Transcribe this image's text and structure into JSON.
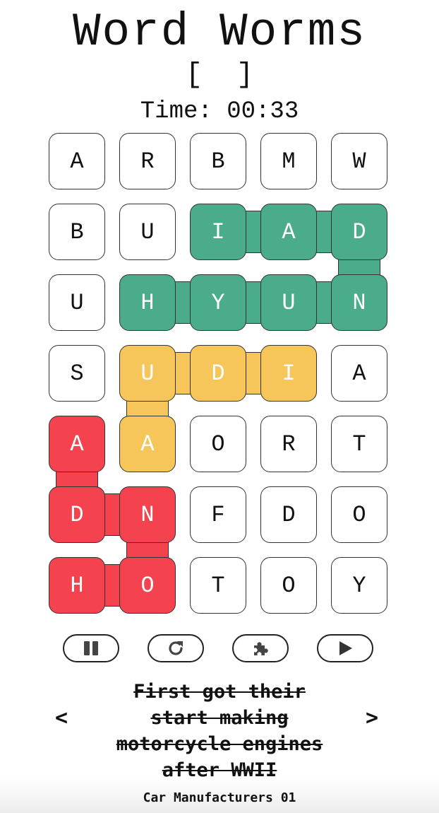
{
  "header": {
    "title": "Word Worms",
    "brackets": "[  ]",
    "timer": "Time: 00:33"
  },
  "colors": {
    "green": "#4aac8a",
    "yellow": "#f6c65a",
    "red": "#f4434e"
  },
  "grid": {
    "rows": [
      [
        "A",
        "R",
        "B",
        "M",
        "W"
      ],
      [
        "B",
        "U",
        "I",
        "A",
        "D"
      ],
      [
        "U",
        "H",
        "Y",
        "U",
        "N"
      ],
      [
        "S",
        "U",
        "D",
        "I",
        "A"
      ],
      [
        "A",
        "A",
        "O",
        "R",
        "T"
      ],
      [
        "D",
        "N",
        "F",
        "D",
        "O"
      ],
      [
        "H",
        "O",
        "T",
        "O",
        "Y"
      ]
    ],
    "tile_colors": [
      [
        "",
        "",
        "",
        "",
        ""
      ],
      [
        "",
        "",
        "green",
        "green",
        "green"
      ],
      [
        "",
        "green",
        "green",
        "green",
        "green"
      ],
      [
        "",
        "yellow",
        "yellow",
        "yellow",
        ""
      ],
      [
        "red",
        "yellow",
        "",
        "",
        ""
      ],
      [
        "red",
        "red",
        "",
        "",
        ""
      ],
      [
        "red",
        "red",
        "",
        "",
        ""
      ]
    ],
    "words": [
      {
        "word": "HYUNDAI",
        "color": "green",
        "path": [
          [
            2,
            1
          ],
          [
            2,
            2
          ],
          [
            2,
            3
          ],
          [
            2,
            4
          ],
          [
            1,
            4
          ],
          [
            1,
            3
          ],
          [
            1,
            2
          ]
        ]
      },
      {
        "word": "AUDI",
        "color": "yellow",
        "path": [
          [
            4,
            1
          ],
          [
            3,
            1
          ],
          [
            3,
            2
          ],
          [
            3,
            3
          ]
        ]
      },
      {
        "word": "HONDA",
        "color": "red",
        "path": [
          [
            6,
            0
          ],
          [
            6,
            1
          ],
          [
            5,
            1
          ],
          [
            5,
            0
          ],
          [
            4,
            0
          ]
        ]
      }
    ]
  },
  "controls": [
    {
      "name": "pause-button",
      "icon": "pause-icon"
    },
    {
      "name": "restart-button",
      "icon": "restart-icon"
    },
    {
      "name": "hint-button",
      "icon": "puzzle-piece-icon"
    },
    {
      "name": "play-button",
      "icon": "play-icon"
    }
  ],
  "clue": {
    "prev": "<",
    "next": ">",
    "lines": [
      "First got their",
      "start making",
      "motorcycle engines",
      "after WWII"
    ]
  },
  "puzzle_name": "Car Manufacturers 01"
}
